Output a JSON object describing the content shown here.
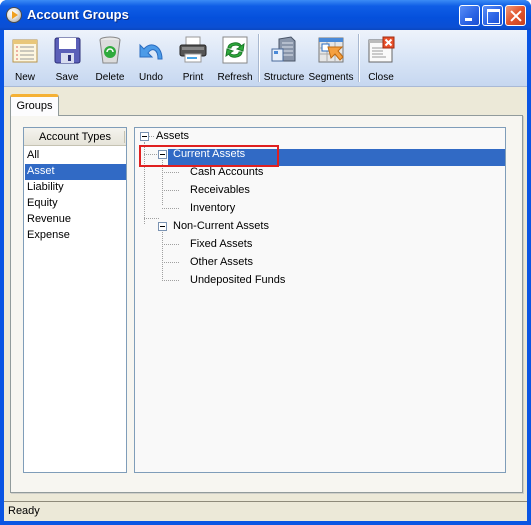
{
  "window": {
    "title": "Account Groups",
    "controls": {
      "minimize": "minimize",
      "maximize": "maximize",
      "close": "close"
    }
  },
  "toolbar": {
    "buttons": [
      {
        "id": "new",
        "label": "New",
        "icon": "new-document-icon"
      },
      {
        "id": "save",
        "label": "Save",
        "icon": "floppy-disk-icon"
      },
      {
        "id": "delete",
        "label": "Delete",
        "icon": "recycle-bin-icon"
      },
      {
        "id": "undo",
        "label": "Undo",
        "icon": "undo-arrow-icon"
      },
      {
        "id": "print",
        "label": "Print",
        "icon": "printer-icon"
      },
      {
        "id": "refresh",
        "label": "Refresh",
        "icon": "refresh-icon"
      },
      {
        "id": "structure",
        "label": "Structure",
        "icon": "building-structure-icon"
      },
      {
        "id": "segments",
        "label": "Segments",
        "icon": "segments-grid-icon"
      },
      {
        "id": "close",
        "label": "Close",
        "icon": "close-window-icon"
      }
    ]
  },
  "tabs": [
    {
      "label": "Groups",
      "active": true
    }
  ],
  "account_types": {
    "header": "Account Types",
    "items": [
      "All",
      "Asset",
      "Liability",
      "Equity",
      "Revenue",
      "Expense"
    ],
    "selected": "Asset"
  },
  "tree": {
    "root": "Assets",
    "current": "Current Assets",
    "current_children": [
      "Cash Accounts",
      "Receivables",
      "Inventory"
    ],
    "noncurrent": "Non-Current Assets",
    "noncurrent_children": [
      "Fixed Assets",
      "Other Assets",
      "Undeposited Funds"
    ],
    "selected": "Current Assets",
    "highlight_color": "#e02020",
    "selection_color": "#316ac5"
  },
  "status": {
    "text": "Ready"
  }
}
